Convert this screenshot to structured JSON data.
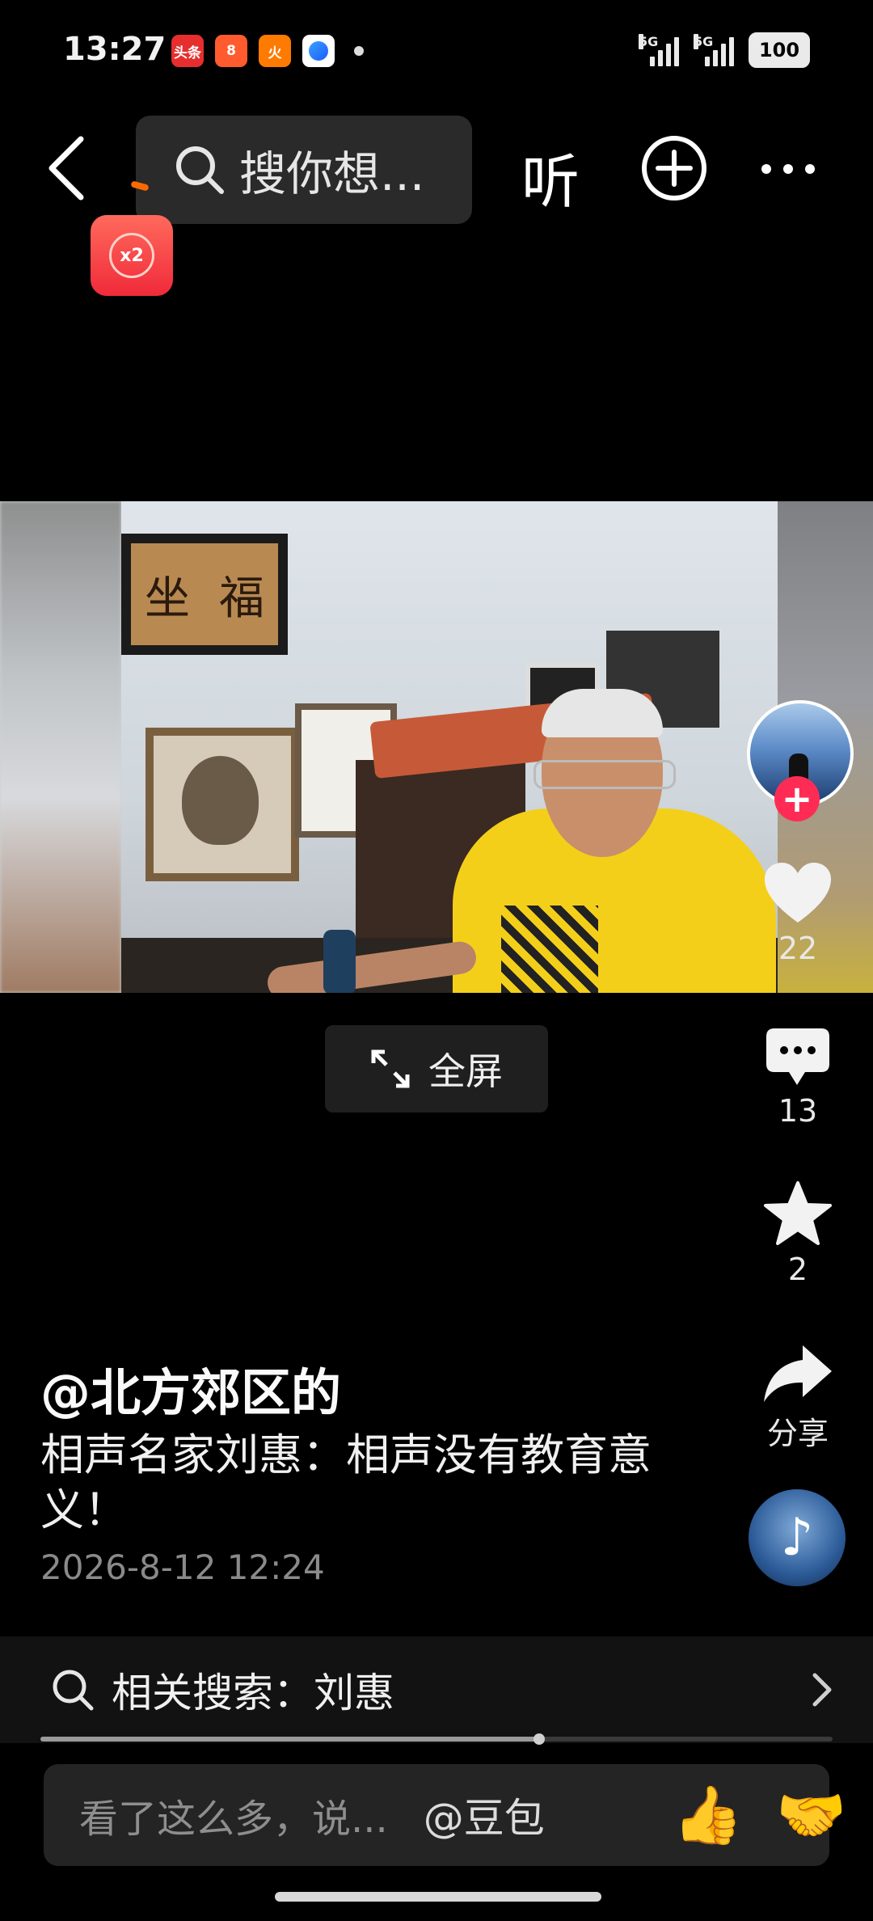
{
  "status_bar": {
    "time": "13:27",
    "notifications": [
      "头条",
      "8",
      "火",
      ""
    ],
    "signal1_label": "5G",
    "signal2_label": "5G",
    "battery": "100"
  },
  "top_nav": {
    "search_placeholder": "搜你想...",
    "listen_label": "听",
    "icons": [
      "back-arrow-icon",
      "search-icon",
      "plus-circle-icon",
      "more-icon"
    ]
  },
  "red_packet": {
    "label": "x2"
  },
  "player": {
    "plaque_chars": [
      "坐",
      "福"
    ],
    "fullscreen_label": "全屏"
  },
  "rail": {
    "likes": "22",
    "comments": "13",
    "favorites": "2",
    "share_label": "分享"
  },
  "caption": {
    "author": "@北方郊区的",
    "description": "相声名家刘惠：相声没有教育意义！",
    "date": "2026-8-12 12:24"
  },
  "related_search": {
    "label": "相关搜索：刘惠"
  },
  "progress": {
    "fraction": 0.63
  },
  "comment_bar": {
    "placeholder": "看了这么多，说...",
    "mention": "@豆包",
    "emoji1": "👍",
    "emoji2": "🤝"
  },
  "colors": {
    "accent": "#fe2c55",
    "background": "#000000"
  }
}
